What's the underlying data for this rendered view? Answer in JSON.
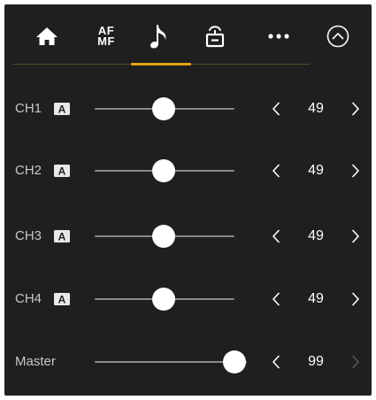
{
  "tabs": [
    {
      "id": "home",
      "icon": "home-icon"
    },
    {
      "id": "focus",
      "label_top": "AF",
      "label_bottom": "MF"
    },
    {
      "id": "audio",
      "icon": "music-note-icon",
      "active": true
    },
    {
      "id": "streaming",
      "icon": "stream-icon"
    },
    {
      "id": "more",
      "icon": "more-icon"
    },
    {
      "id": "collapse",
      "icon": "chevron-up-circle-icon"
    }
  ],
  "channels": [
    {
      "label": "CH1",
      "auto_badge": "A",
      "value": "49",
      "level": 0.49
    },
    {
      "label": "CH2",
      "auto_badge": "A",
      "value": "49",
      "level": 0.49
    },
    {
      "label": "CH3",
      "auto_badge": "A",
      "value": "49",
      "level": 0.49
    },
    {
      "label": "CH4",
      "auto_badge": "A",
      "value": "49",
      "level": 0.49
    }
  ],
  "master": {
    "label": "Master",
    "value": "99",
    "level": 0.99,
    "increment_disabled": true
  },
  "colors": {
    "background": "#1f1f1f",
    "accent": "#e0a216",
    "text": "#c8c8c8",
    "value_text": "#ffffff",
    "track": "#8a8a8a",
    "thumb": "#ffffff",
    "disabled": "#5a5a5a"
  }
}
